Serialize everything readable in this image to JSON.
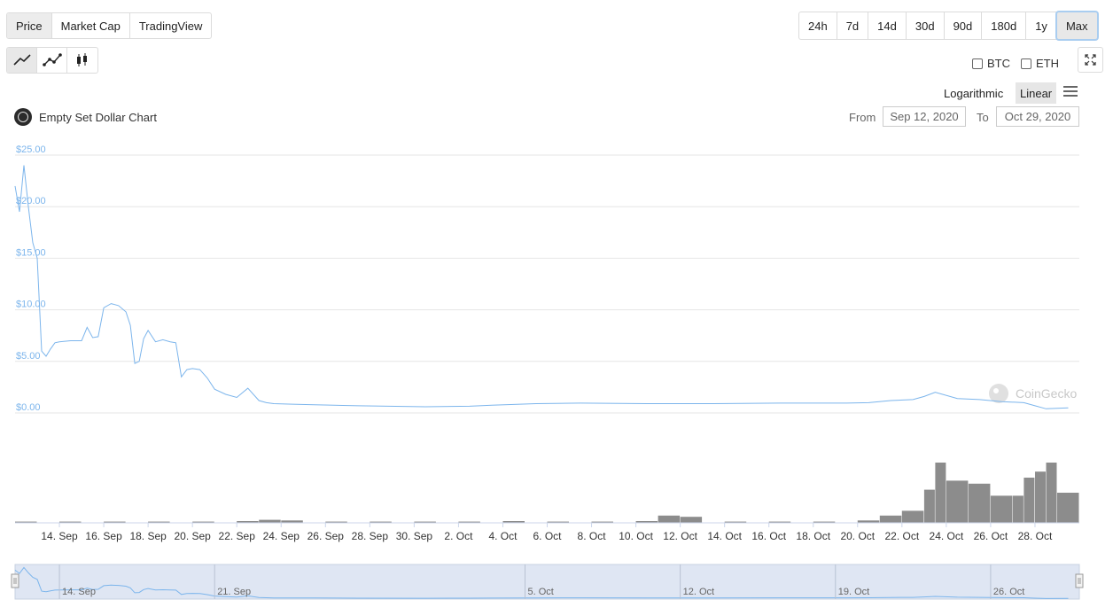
{
  "view_tabs": [
    {
      "label": "Price",
      "active": true
    },
    {
      "label": "Market Cap",
      "active": false
    },
    {
      "label": "TradingView",
      "active": false
    }
  ],
  "range_tabs": [
    {
      "label": "24h",
      "active": false
    },
    {
      "label": "7d",
      "active": false
    },
    {
      "label": "14d",
      "active": false
    },
    {
      "label": "30d",
      "active": false
    },
    {
      "label": "90d",
      "active": false
    },
    {
      "label": "180d",
      "active": false
    },
    {
      "label": "1y",
      "active": false
    },
    {
      "label": "Max",
      "active": true
    }
  ],
  "chart_types": [
    {
      "icon": "line-chart-icon",
      "active": true
    },
    {
      "icon": "line-dots-chart-icon",
      "active": false
    },
    {
      "icon": "candlestick-chart-icon",
      "active": false
    }
  ],
  "compare": [
    {
      "label": "BTC",
      "checked": false
    },
    {
      "label": "ETH",
      "checked": false
    }
  ],
  "scale": {
    "log_label": "Logarithmic",
    "linear_label": "Linear",
    "active": "linear"
  },
  "coin": {
    "title": "Empty Set Dollar Chart"
  },
  "date_range": {
    "from_label": "From",
    "from_value": "Sep 12, 2020",
    "to_label": "To",
    "to_value": "Oct 29, 2020"
  },
  "colors": {
    "price_line": "#7cb5ec",
    "volume_bar": "#8c8c8c",
    "grid": "#e6e6e6",
    "navigator_fill": "#dfe6f3",
    "axis_label": "#7cb5ec"
  },
  "chart_data": [
    {
      "type": "line",
      "series": [
        {
          "x": [
            "2020-09-12",
            "2020-09-12",
            "2020-09-12",
            "2020-09-12",
            "2020-09-12",
            "2020-09-13",
            "2020-09-13",
            "2020-09-13",
            "2020-09-13",
            "2020-09-13",
            "2020-09-14",
            "2020-09-14",
            "2020-09-15",
            "2020-09-15",
            "2020-09-15",
            "2020-09-15",
            "2020-09-16",
            "2020-09-16",
            "2020-09-16",
            "2020-09-17",
            "2020-09-17",
            "2020-09-17",
            "2020-09-17",
            "2020-09-17",
            "2020-09-18",
            "2020-09-18",
            "2020-09-18",
            "2020-09-19",
            "2020-09-19",
            "2020-09-19",
            "2020-09-19",
            "2020-09-20",
            "2020-09-20",
            "2020-09-20",
            "2020-09-21",
            "2020-09-21",
            "2020-09-22",
            "2020-09-22",
            "2020-09-23",
            "2020-09-23",
            "2020-09-23",
            "2020-09-24",
            "2020-09-25",
            "2020-09-27",
            "2020-09-30",
            "2020-10-02",
            "2020-10-03",
            "2020-10-05",
            "2020-10-07",
            "2020-10-10",
            "2020-10-13",
            "2020-10-16",
            "2020-10-19",
            "2020-10-20",
            "2020-10-21",
            "2020-10-22",
            "2020-10-23",
            "2020-10-23",
            "2020-10-24",
            "2020-10-25",
            "2020-10-26",
            "2020-10-27",
            "2020-10-28",
            "2020-10-28",
            "2020-10-29"
          ],
          "y": [
            22.0,
            19.5,
            24.0,
            20.0,
            16.5,
            15.0,
            6.0,
            5.5,
            6.2,
            6.8,
            6.9,
            7.0,
            7.0,
            8.3,
            7.3,
            7.4,
            10.2,
            10.6,
            10.4,
            9.8,
            8.5,
            4.8,
            5.0,
            7.2,
            8.0,
            6.9,
            7.1,
            6.9,
            6.8,
            3.5,
            4.2,
            4.3,
            4.2,
            3.4,
            2.3,
            1.8,
            1.5,
            2.4,
            1.2,
            1.0,
            0.9,
            0.85,
            0.8,
            0.7,
            0.6,
            0.65,
            0.75,
            0.9,
            0.95,
            0.9,
            0.9,
            0.95,
            0.95,
            1.0,
            1.2,
            1.3,
            1.6,
            2.0,
            1.4,
            1.3,
            1.1,
            1.0,
            0.7,
            0.4,
            0.5
          ]
        }
      ],
      "x_ticks": [
        "14. Sep",
        "16. Sep",
        "18. Sep",
        "20. Sep",
        "22. Sep",
        "24. Sep",
        "26. Sep",
        "28. Sep",
        "30. Sep",
        "2. Oct",
        "4. Oct",
        "6. Oct",
        "8. Oct",
        "10. Oct",
        "12. Oct",
        "14. Oct",
        "16. Oct",
        "18. Oct",
        "20. Oct",
        "22. Oct",
        "24. Oct",
        "26. Oct",
        "28. Oct"
      ],
      "y_ticks": [
        "$0.00",
        "$5.00",
        "$10.00",
        "$15.00",
        "$20.00",
        "$25.00"
      ],
      "ylim": [
        0,
        25
      ],
      "xlim": [
        "2020-09-12",
        "2020-10-29"
      ],
      "grid": true,
      "watermark": "CoinGecko"
    },
    {
      "type": "bar",
      "series": [
        {
          "x": [
            "2020-09-12",
            "2020-09-14",
            "2020-09-16",
            "2020-09-18",
            "2020-09-20",
            "2020-09-22",
            "2020-09-23",
            "2020-09-24",
            "2020-09-26",
            "2020-09-28",
            "2020-09-30",
            "2020-10-02",
            "2020-10-04",
            "2020-10-06",
            "2020-10-08",
            "2020-10-10",
            "2020-10-11",
            "2020-10-12",
            "2020-10-14",
            "2020-10-16",
            "2020-10-18",
            "2020-10-20",
            "2020-10-21",
            "2020-10-22",
            "2020-10-23",
            "2020-10-23",
            "2020-10-24",
            "2020-10-25",
            "2020-10-26",
            "2020-10-27",
            "2020-10-27",
            "2020-10-28",
            "2020-10-28",
            "2020-10-29"
          ],
          "y": [
            0.02,
            0.02,
            0.02,
            0.02,
            0.02,
            0.03,
            0.05,
            0.04,
            0.02,
            0.02,
            0.02,
            0.02,
            0.03,
            0.02,
            0.02,
            0.03,
            0.12,
            0.1,
            0.02,
            0.02,
            0.02,
            0.04,
            0.12,
            0.2,
            0.55,
            1.0,
            0.7,
            0.65,
            0.45,
            0.45,
            0.75,
            0.85,
            1.0,
            0.5
          ]
        }
      ],
      "ylim": [
        0,
        1
      ]
    },
    {
      "type": "area",
      "x_ticks": [
        "14. Sep",
        "21. Sep",
        "5. Oct",
        "12. Oct",
        "19. Oct",
        "26. Oct"
      ]
    }
  ]
}
